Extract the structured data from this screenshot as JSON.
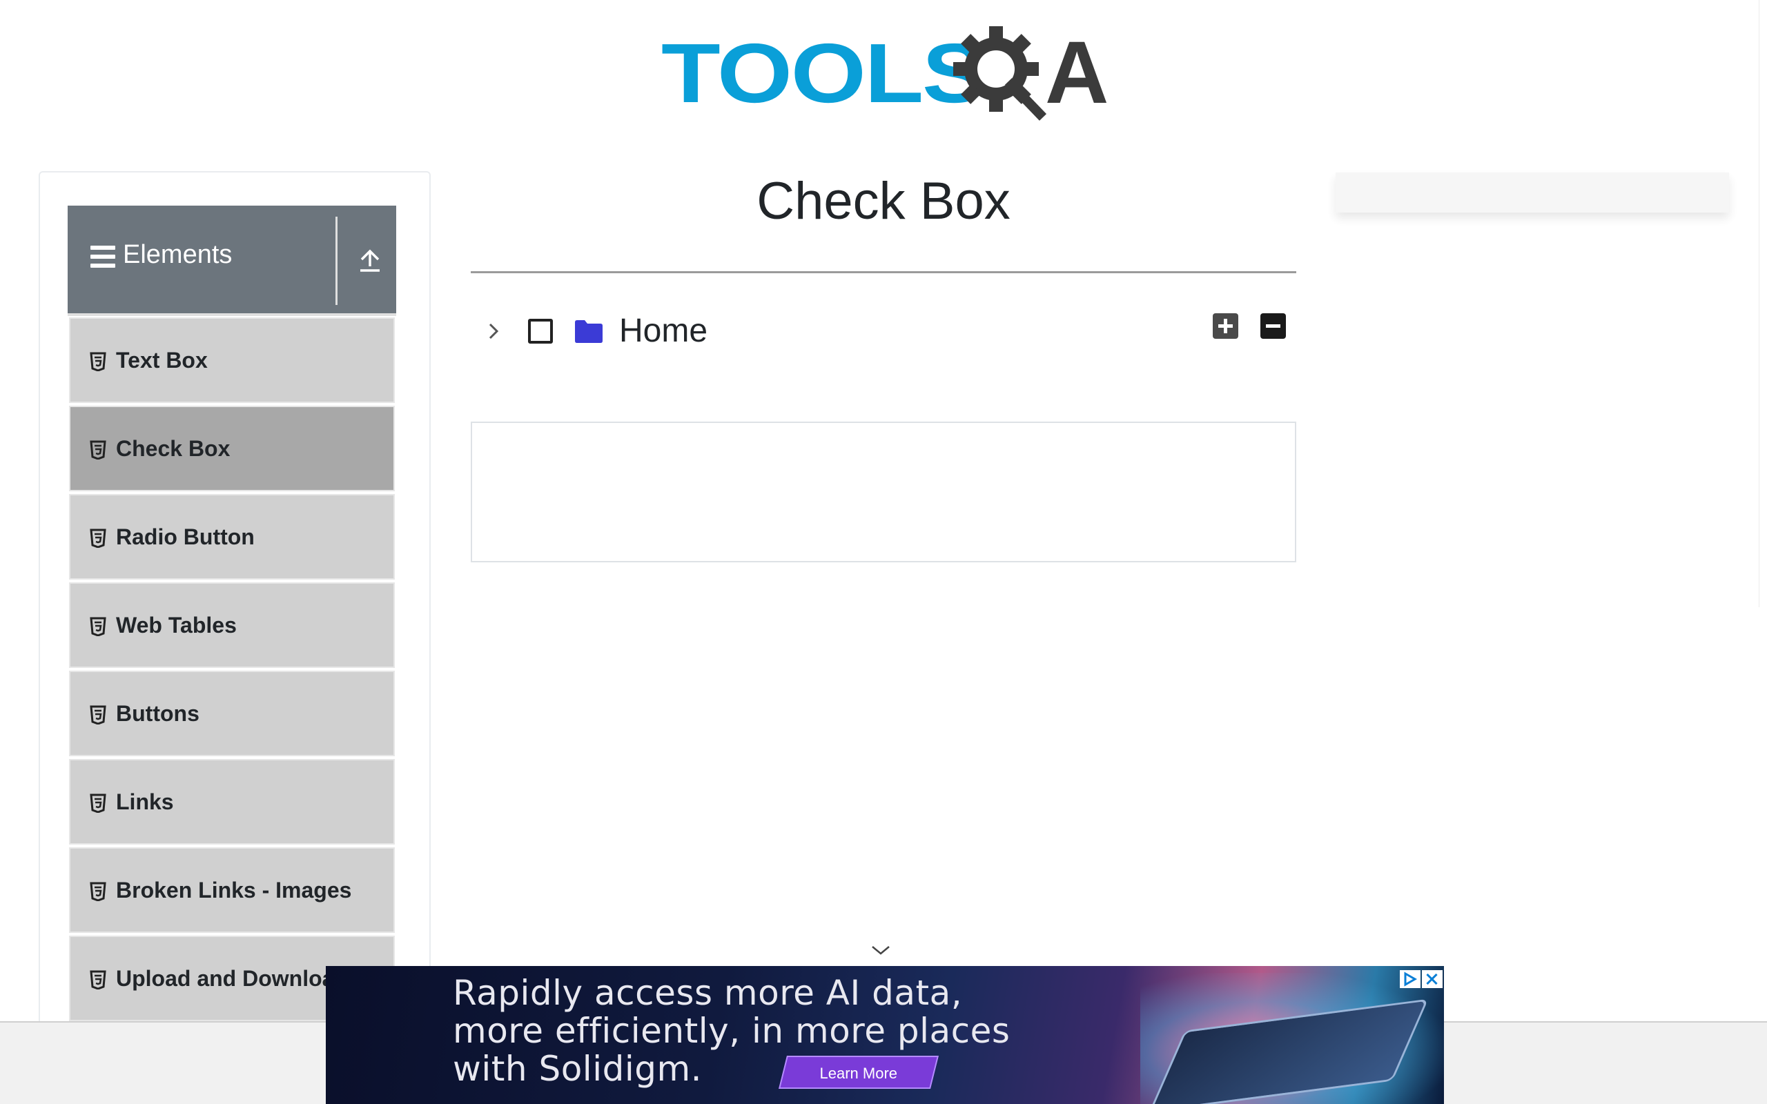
{
  "brand": {
    "logo_text": "TOOLSQA"
  },
  "sidebar": {
    "group_title": "Elements",
    "items": [
      {
        "label": "Text Box",
        "active": false
      },
      {
        "label": "Check Box",
        "active": true
      },
      {
        "label": "Radio Button",
        "active": false
      },
      {
        "label": "Web Tables",
        "active": false
      },
      {
        "label": "Buttons",
        "active": false
      },
      {
        "label": "Links",
        "active": false
      },
      {
        "label": "Broken Links - Images",
        "active": false
      },
      {
        "label": "Upload and Download",
        "active": false
      }
    ]
  },
  "main": {
    "title": "Check Box",
    "tree": {
      "root_label": "Home",
      "checked": false,
      "expanded": false
    },
    "controls": {
      "expand_all_icon": "plus-square-icon",
      "collapse_all_icon": "minus-square-icon"
    }
  },
  "ad": {
    "text_line_1": "Rapidly access more AI data,",
    "text_line_2": "more efficiently, in more places",
    "text_line_3": "with Solidigm.",
    "cta": "Learn More"
  },
  "colors": {
    "header_bg": "#6c757d",
    "menu_item_bg": "#d0d0d0",
    "menu_item_active_bg": "#a8a8a8",
    "logo_blue": "#0a9fd8",
    "logo_dark": "#3b3b3b",
    "folder": "#3b3bd6"
  }
}
